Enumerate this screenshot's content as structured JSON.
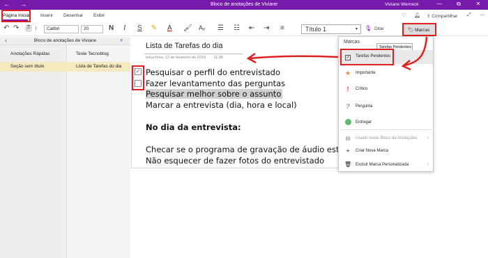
{
  "window": {
    "title": "Bloco de anotações de Viviane",
    "user": "Viviane Werneck",
    "nav_back": "←",
    "nav_forward": "→",
    "minimize": "—",
    "restore": "⧉",
    "close": "✕"
  },
  "ribbon": {
    "tabs": [
      "Página Inicial",
      "Inserir",
      "Desenhar",
      "Exibir"
    ],
    "active_tab": "Página Inicial",
    "share_label": "Compartilhar"
  },
  "toolbar": {
    "font": "Calibri",
    "size": "20",
    "bold": "N",
    "italic": "I",
    "underline": "S",
    "style": "Título 1",
    "dictate": "Ditar",
    "tags_button": "Marcas"
  },
  "sidebar": {
    "notebook": "Bloco de anotações de Viviane",
    "sections": [
      {
        "label": "Anotações Rápidas",
        "selected": false
      },
      {
        "label": "Seção sem título",
        "selected": true
      }
    ],
    "pages": [
      {
        "label": "Teste Tecnoblog",
        "selected": false
      },
      {
        "label": "Lista de Tarefas do dia",
        "selected": true
      }
    ]
  },
  "page": {
    "title": "Lista de Tarefas do dia",
    "date": "terça-feira, 12 de fevereiro de 2019",
    "time": "11:38",
    "lines": [
      {
        "text": "Pesquisar o perfil do entrevistado",
        "checkbox": true,
        "checked": true
      },
      {
        "text": "Fazer levantamento das perguntas",
        "checkbox": true,
        "checked": false
      },
      {
        "text": "Pesquisar melhor sobre o assunto",
        "highlight": true
      },
      {
        "text": "Marcar a entrevista (dia, hora e local)"
      },
      {
        "text": "No dia da entrevista:",
        "bold": true
      },
      {
        "text": "Checar se o programa de gravação de áudio está ok"
      },
      {
        "text": "Não esquecer de fazer fotos do entrevistado"
      }
    ]
  },
  "tags_menu": {
    "title": "Marcas",
    "tooltip": "Tarefas Pendentes",
    "items": [
      {
        "label": "Tarefas Pendentes",
        "icon": "checkbox-icon",
        "selected": true
      },
      {
        "label": "Importante",
        "icon": "star-icon",
        "color": "#e8892c"
      },
      {
        "label": "Crítico",
        "icon": "exclamation-icon",
        "color": "#d83b3b"
      },
      {
        "label": "Pergunta",
        "icon": "question-icon",
        "color": "#8e44ad"
      },
      {
        "label": "Entregar",
        "icon": "green-circle-icon",
        "color": "#5bbb6b"
      }
    ],
    "footer": [
      {
        "label": "Usado neste Bloco de Anotações",
        "disabled": true
      },
      {
        "label": "Criar Nova Marca"
      },
      {
        "label": "Excluir Marca Personalizada"
      }
    ]
  },
  "colors": {
    "accent": "#7719aa",
    "annotation_red": "#e02020",
    "selection_bg": "#f6e8bf"
  }
}
